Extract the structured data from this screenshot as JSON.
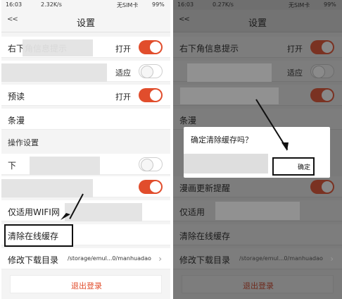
{
  "left": {
    "status": {
      "time": "16:03",
      "speed": "2.32K/s",
      "carrier": "无SIM卡",
      "battery": "99%"
    },
    "header": {
      "back_icon": "<<",
      "title": "设置"
    },
    "rows": [
      {
        "label": "右下角信息提示",
        "value": "打开",
        "toggle": "on"
      },
      {
        "label": "",
        "value": "适应",
        "toggle": "off"
      },
      {
        "label": "预读",
        "value": "打开",
        "toggle": "on"
      },
      {
        "label": "条漫",
        "value": "",
        "toggle": "none"
      }
    ],
    "section": "操作设置",
    "rows2": [
      {
        "label": "下",
        "value": "",
        "toggle": "off"
      },
      {
        "label": "",
        "value": "",
        "toggle": "on"
      },
      {
        "label": "仅适用WIFI网",
        "value": "",
        "toggle": "none"
      },
      {
        "label": "清除在线缓存",
        "value": "",
        "toggle": "none"
      },
      {
        "label": "修改下载目录",
        "value": "/storage/emul...0/manhuadao",
        "toggle": "chevron"
      }
    ],
    "logout": "退出登录"
  },
  "right": {
    "status": {
      "time": "16:03",
      "speed": "0.27K/s",
      "carrier": "无SIM卡",
      "battery": "99%"
    },
    "header": {
      "back_icon": "<<",
      "title": "设置"
    },
    "rows": [
      {
        "label": "右下角信息提示",
        "value": "打开",
        "toggle": "on"
      },
      {
        "label": "",
        "value": "适应",
        "toggle": "off"
      },
      {
        "label": "",
        "value": "",
        "toggle": "on"
      },
      {
        "label": "条漫",
        "value": "",
        "toggle": "none"
      }
    ],
    "dialog": {
      "message": "确定清除缓存吗？",
      "ok": "确定"
    },
    "rows2": [
      {
        "label": "漫画更新提醒",
        "value": "",
        "toggle": "on"
      },
      {
        "label": "仅适用",
        "value": "",
        "toggle": "none"
      },
      {
        "label": "清除在线缓存",
        "value": "",
        "toggle": "none"
      },
      {
        "label": "修改下载目录",
        "value": "/storage/emul...0/manhuadao",
        "toggle": "chevron"
      }
    ],
    "logout": "退出登录"
  },
  "colors": {
    "accent": "#e14d2c",
    "overlay": "#7a7a7a"
  },
  "icons": {
    "back": "back-chevrons-icon",
    "chevron": "chevron-right-icon",
    "pointer": "arrow-pointer-icon"
  }
}
